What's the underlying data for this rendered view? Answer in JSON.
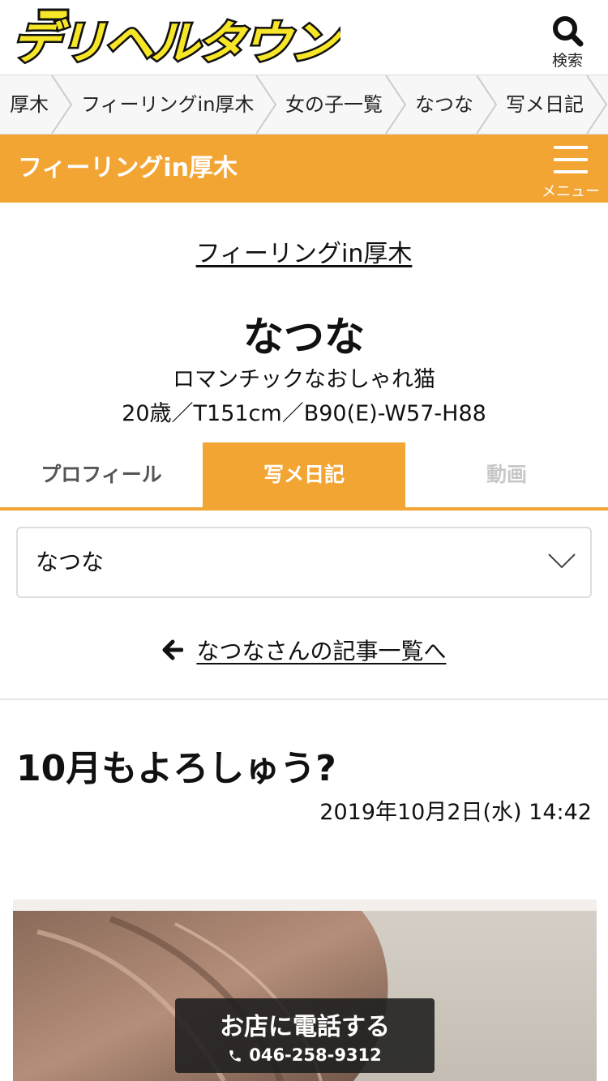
{
  "header": {
    "logo_text": "デリヘルタウン",
    "search_label": "検索"
  },
  "breadcrumb": [
    "厚木",
    "フィーリングin厚木",
    "女の子一覧",
    "なつな",
    "写メ日記"
  ],
  "shopbar": {
    "title": "フィーリングin厚木",
    "menu_label": "メニュー"
  },
  "shop_link": "フィーリングin厚木",
  "girl": {
    "name": "なつな",
    "catchphrase": "ロマンチックなおしゃれ猫",
    "spec": "20歳／T151cm／B90(E)-W57-H88"
  },
  "tabs": [
    {
      "label": "プロフィール",
      "active": false
    },
    {
      "label": "写メ日記",
      "active": true
    },
    {
      "label": "動画",
      "active": false
    }
  ],
  "selector": {
    "value": "なつな"
  },
  "back_link": "なつなさんの記事一覧へ",
  "article": {
    "title": "10月もよろしゅう?",
    "date": "2019年10月2日(水) 14:42"
  },
  "call": {
    "label": "お店に電話する",
    "number": "046-258-9312"
  },
  "colors": {
    "accent": "#f3a534",
    "logo_yellow": "#f7e627"
  }
}
